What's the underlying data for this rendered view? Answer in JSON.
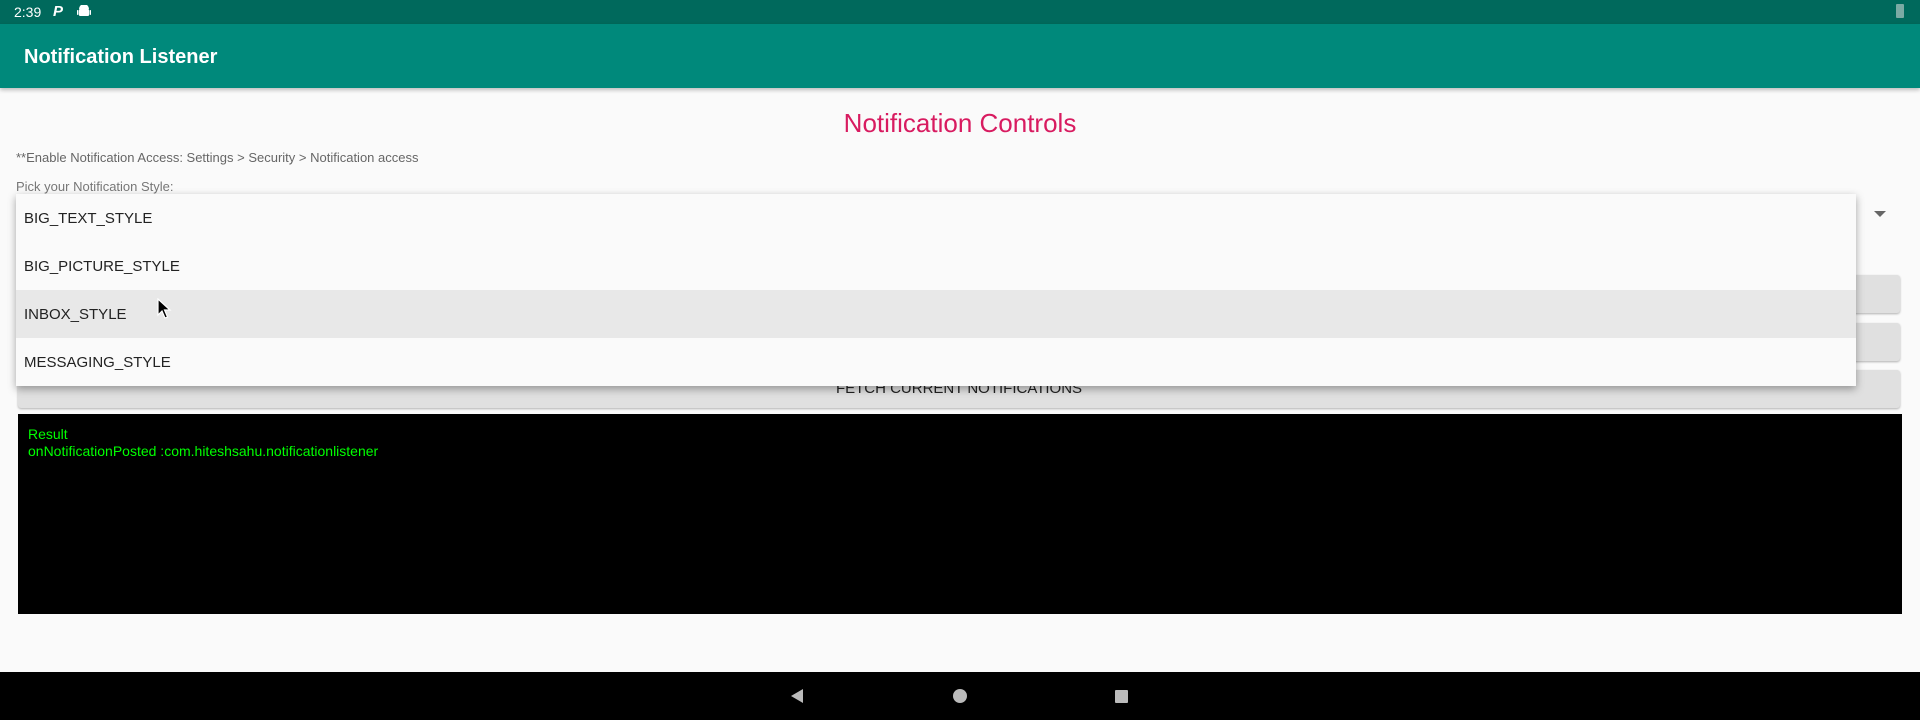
{
  "status_bar": {
    "time": "2:39",
    "icons": [
      "p-app-icon",
      "android-icon",
      "battery-icon"
    ]
  },
  "app_bar": {
    "title": "Notification Listener"
  },
  "main": {
    "heading": "Notification Controls",
    "access_hint": "**Enable Notification Access: Settings > Security > Notification access",
    "style_label": "Pick your Notification Style:",
    "buttons": [
      "",
      "",
      "FETCH CURRENT NOTIFICATIONS"
    ],
    "result": {
      "title": "Result",
      "text": "onNotificationPosted :com.hiteshsahu.notificationlistener"
    }
  },
  "dropdown": {
    "items": [
      "BIG_TEXT_STYLE",
      "BIG_PICTURE_STYLE",
      "INBOX_STYLE",
      "MESSAGING_STYLE"
    ],
    "highlighted": "INBOX_STYLE"
  },
  "colors": {
    "status_bar": "#00695c",
    "app_bar": "#00897b",
    "heading": "#d81b60",
    "result_text": "#00ff00"
  }
}
